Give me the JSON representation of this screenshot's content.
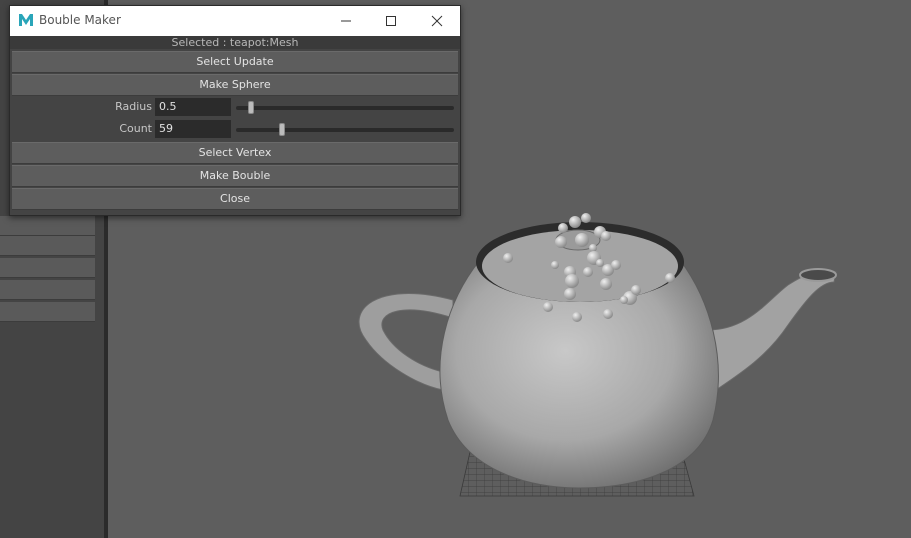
{
  "window": {
    "title": "Bouble Maker",
    "status": "Selected : teapot:Mesh",
    "buttons": {
      "select_update": "Select Update",
      "make_sphere": "Make Sphere",
      "select_vertex": "Select Vertex",
      "make_bouble": "Make Bouble",
      "close": "Close"
    },
    "radius": {
      "label": "Radius",
      "value": "0.5",
      "slider_fraction": 0.07
    },
    "count": {
      "label": "Count",
      "value": "59",
      "slider_fraction": 0.21
    },
    "titlebar_icons": [
      "app-icon",
      "minimize-icon",
      "maximize-icon",
      "close-icon"
    ]
  },
  "colors": {
    "window_bg": "#444444",
    "button_bg": "#5d5d5d",
    "field_bg": "#2b2b2b",
    "viewport_bg": "#5e5e5e",
    "app_icon": "#2aa5b9"
  }
}
